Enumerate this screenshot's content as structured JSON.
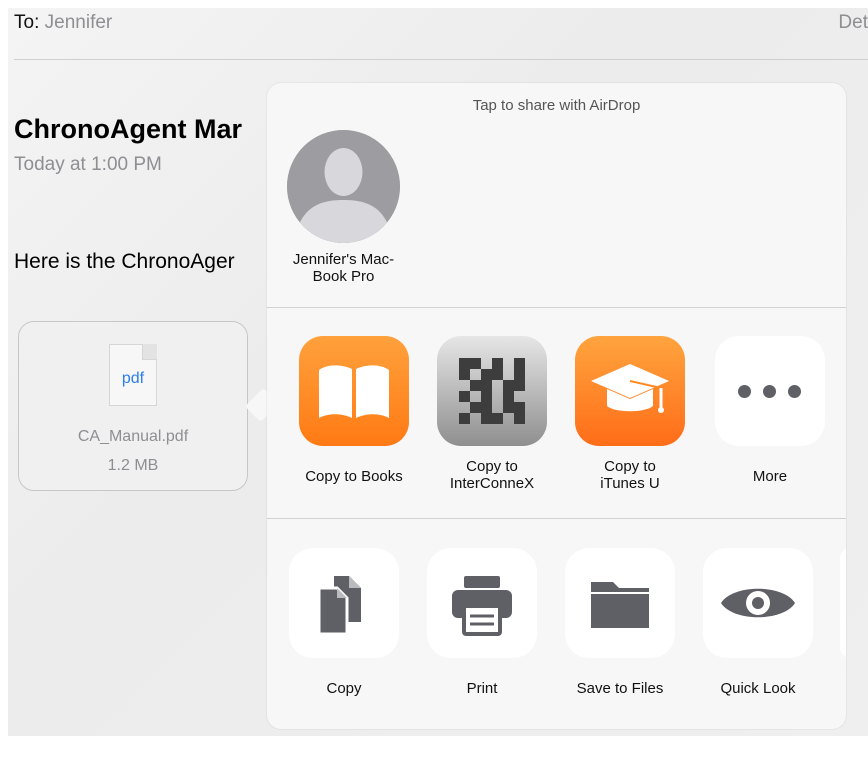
{
  "mail": {
    "to_label": "To:",
    "to_name": "Jennifer",
    "details_label": "Det",
    "subject": "ChronoAgent Mar",
    "date": "Today at 1:00 PM",
    "body": "Here is the ChronoAger"
  },
  "attachment": {
    "file_type": "pdf",
    "file_name": "CA_Manual.pdf",
    "file_size": "1.2 MB"
  },
  "share_sheet": {
    "airdrop_title": "Tap to share with AirDrop",
    "airdrop_device_line1": "Jennifer's Mac-",
    "airdrop_device_line2": "Book Pro",
    "apps": [
      {
        "line1": "Copy to Books",
        "line2": "",
        "icon": "books-icon"
      },
      {
        "line1": "Copy to",
        "line2": "InterConneX",
        "icon": "interconnex-icon"
      },
      {
        "line1": "Copy to",
        "line2": "iTunes U",
        "icon": "itunes-u-icon"
      },
      {
        "line1": "More",
        "line2": "",
        "icon": "more-icon"
      }
    ],
    "actions": [
      {
        "label": "Copy",
        "icon": "copy-icon"
      },
      {
        "label": "Print",
        "icon": "print-icon"
      },
      {
        "label": "Save to Files",
        "icon": "folder-icon"
      },
      {
        "label": "Quick Look",
        "icon": "eye-icon"
      }
    ]
  },
  "colors": {
    "accent_orange": "#ff8a1f",
    "icon_gray": "#5f5f66",
    "link_blue": "#2b7de9"
  }
}
